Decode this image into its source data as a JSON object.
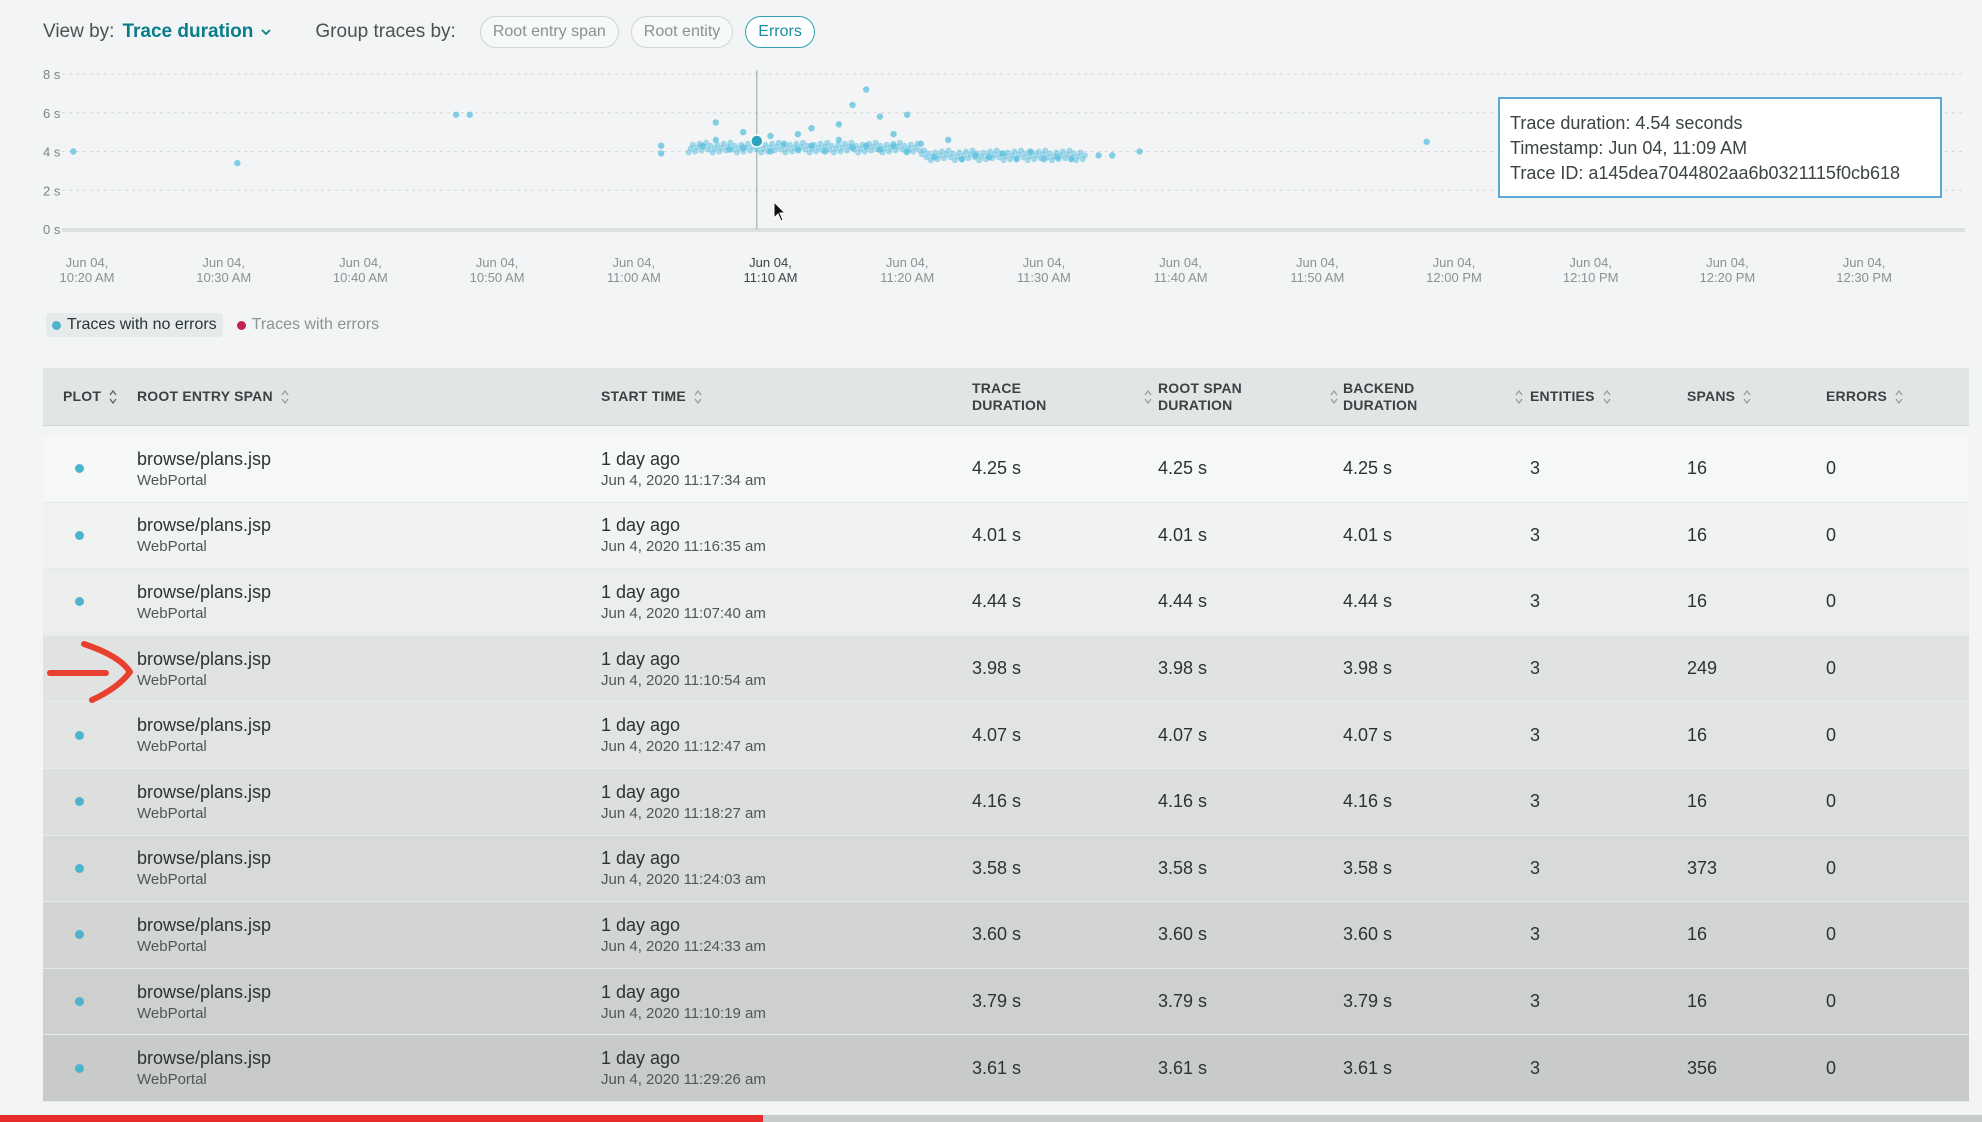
{
  "toolbar": {
    "view_by_label": "View by:",
    "view_by_value": "Trace duration",
    "group_by_label": "Group traces by:",
    "group_options": [
      "Root entry span",
      "Root entity",
      "Errors"
    ],
    "active_group": "Errors"
  },
  "chart_data": {
    "type": "scatter",
    "y_ticks": [
      "8 s",
      "6 s",
      "4 s",
      "2 s",
      "0 s"
    ],
    "ylim": [
      0,
      8
    ],
    "x_ticks": [
      [
        "Jun 04,",
        "10:20 AM"
      ],
      [
        "Jun 04,",
        "10:30 AM"
      ],
      [
        "Jun 04,",
        "10:40 AM"
      ],
      [
        "Jun 04,",
        "10:50 AM"
      ],
      [
        "Jun 04,",
        "11:00 AM"
      ],
      [
        "Jun 04,",
        "11:10 AM"
      ],
      [
        "Jun 04,",
        "11:20 AM"
      ],
      [
        "Jun 04,",
        "11:30 AM"
      ],
      [
        "Jun 04,",
        "11:40 AM"
      ],
      [
        "Jun 04,",
        "11:50 AM"
      ],
      [
        "Jun 04,",
        "12:00 PM"
      ],
      [
        "Jun 04,",
        "12:10 PM"
      ],
      [
        "Jun 04,",
        "12:20 PM"
      ],
      [
        "Jun 04,",
        "12:30 PM"
      ]
    ],
    "highlighted_tick": "11:10 AM",
    "series": [
      {
        "name": "Traces with no errors",
        "color": "#5bc0de",
        "points": [
          [
            "10:19",
            4.0
          ],
          [
            "10:31",
            3.4
          ],
          [
            "10:47",
            5.9
          ],
          [
            "10:48",
            5.9
          ],
          [
            "11:02",
            3.9
          ],
          [
            "11:02",
            4.3
          ],
          [
            "11:05",
            4.3
          ],
          [
            "11:06",
            5.5
          ],
          [
            "11:06",
            4.6
          ],
          [
            "11:07",
            4.1
          ],
          [
            "11:08",
            5.0
          ],
          [
            "11:08",
            4.2
          ],
          [
            "11:09",
            4.3
          ],
          [
            "11:09",
            4.54
          ],
          [
            "11:10",
            4.8
          ],
          [
            "11:10",
            4.0
          ],
          [
            "11:11",
            4.4
          ],
          [
            "11:12",
            4.9
          ],
          [
            "11:12",
            4.1
          ],
          [
            "11:13",
            5.2
          ],
          [
            "11:13",
            4.3
          ],
          [
            "11:14",
            4.0
          ],
          [
            "11:15",
            5.4
          ],
          [
            "11:15",
            4.6
          ],
          [
            "11:16",
            6.4
          ],
          [
            "11:16",
            4.2
          ],
          [
            "11:17",
            7.2
          ],
          [
            "11:17",
            4.3
          ],
          [
            "11:18",
            5.8
          ],
          [
            "11:18",
            4.1
          ],
          [
            "11:19",
            4.9
          ],
          [
            "11:19",
            4.3
          ],
          [
            "11:20",
            5.9
          ],
          [
            "11:20",
            4.0
          ],
          [
            "11:21",
            4.4
          ],
          [
            "11:22",
            3.7
          ],
          [
            "11:23",
            4.6
          ],
          [
            "11:24",
            3.6
          ],
          [
            "11:25",
            3.8
          ],
          [
            "11:26",
            3.7
          ],
          [
            "11:27",
            3.9
          ],
          [
            "11:28",
            3.6
          ],
          [
            "11:29",
            4.0
          ],
          [
            "11:30",
            3.6
          ],
          [
            "11:31",
            3.7
          ],
          [
            "11:32",
            3.6
          ],
          [
            "11:34",
            3.8
          ],
          [
            "11:35",
            3.8
          ],
          [
            "11:37",
            4.0
          ],
          [
            "11:58",
            4.5
          ]
        ]
      },
      {
        "name": "Traces with errors",
        "color": "#c0234d",
        "points": []
      }
    ]
  },
  "tooltip": {
    "line1": "Trace duration: 4.54 seconds",
    "line2": "Timestamp: Jun 04, 11:09 AM",
    "line3": "Trace ID: a145dea7044802aa6b0321115f0cb618"
  },
  "legend": {
    "no_errors": "Traces with no errors",
    "with_errors": "Traces with errors",
    "no_errors_color": "#4fb3cf",
    "with_errors_color": "#c0234d"
  },
  "table": {
    "headers": {
      "plot": "PLOT",
      "root_entry_span": "ROOT ENTRY SPAN",
      "start_time": "START TIME",
      "trace_duration_1": "TRACE",
      "trace_duration_2": "DURATION",
      "root_span_duration_1": "ROOT SPAN",
      "root_span_duration_2": "DURATION",
      "backend_duration_1": "BACKEND",
      "backend_duration_2": "DURATION",
      "entities": "ENTITIES",
      "spans": "SPANS",
      "errors": "ERRORS"
    },
    "rows": [
      {
        "plot": true,
        "span": "browse/plans.jsp",
        "entity": "WebPortal",
        "ago": "1 day ago",
        "ts": "Jun 4, 2020 11:17:34 am",
        "trace": "4.25 s",
        "root": "4.25 s",
        "backend": "4.25 s",
        "entities": "3",
        "spans": "16",
        "errors": "0"
      },
      {
        "plot": true,
        "span": "browse/plans.jsp",
        "entity": "WebPortal",
        "ago": "1 day ago",
        "ts": "Jun 4, 2020 11:16:35 am",
        "trace": "4.01 s",
        "root": "4.01 s",
        "backend": "4.01 s",
        "entities": "3",
        "spans": "16",
        "errors": "0"
      },
      {
        "plot": true,
        "span": "browse/plans.jsp",
        "entity": "WebPortal",
        "ago": "1 day ago",
        "ts": "Jun 4, 2020 11:07:40 am",
        "trace": "4.44 s",
        "root": "4.44 s",
        "backend": "4.44 s",
        "entities": "3",
        "spans": "16",
        "errors": "0"
      },
      {
        "plot": false,
        "span": "browse/plans.jsp",
        "entity": "WebPortal",
        "ago": "1 day ago",
        "ts": "Jun 4, 2020 11:10:54 am",
        "trace": "3.98 s",
        "root": "3.98 s",
        "backend": "3.98 s",
        "entities": "3",
        "spans": "249",
        "errors": "0"
      },
      {
        "plot": true,
        "span": "browse/plans.jsp",
        "entity": "WebPortal",
        "ago": "1 day ago",
        "ts": "Jun 4, 2020 11:12:47 am",
        "trace": "4.07 s",
        "root": "4.07 s",
        "backend": "4.07 s",
        "entities": "3",
        "spans": "16",
        "errors": "0"
      },
      {
        "plot": true,
        "span": "browse/plans.jsp",
        "entity": "WebPortal",
        "ago": "1 day ago",
        "ts": "Jun 4, 2020 11:18:27 am",
        "trace": "4.16 s",
        "root": "4.16 s",
        "backend": "4.16 s",
        "entities": "3",
        "spans": "16",
        "errors": "0"
      },
      {
        "plot": true,
        "span": "browse/plans.jsp",
        "entity": "WebPortal",
        "ago": "1 day ago",
        "ts": "Jun 4, 2020 11:24:03 am",
        "trace": "3.58 s",
        "root": "3.58 s",
        "backend": "3.58 s",
        "entities": "3",
        "spans": "373",
        "errors": "0"
      },
      {
        "plot": true,
        "span": "browse/plans.jsp",
        "entity": "WebPortal",
        "ago": "1 day ago",
        "ts": "Jun 4, 2020 11:24:33 am",
        "trace": "3.60 s",
        "root": "3.60 s",
        "backend": "3.60 s",
        "entities": "3",
        "spans": "16",
        "errors": "0"
      },
      {
        "plot": true,
        "span": "browse/plans.jsp",
        "entity": "WebPortal",
        "ago": "1 day ago",
        "ts": "Jun 4, 2020 11:10:19 am",
        "trace": "3.79 s",
        "root": "3.79 s",
        "backend": "3.79 s",
        "entities": "3",
        "spans": "16",
        "errors": "0"
      },
      {
        "plot": true,
        "span": "browse/plans.jsp",
        "entity": "WebPortal",
        "ago": "1 day ago",
        "ts": "Jun 4, 2020 11:29:26 am",
        "trace": "3.61 s",
        "root": "3.61 s",
        "backend": "3.61 s",
        "entities": "3",
        "spans": "356",
        "errors": "0"
      }
    ],
    "highlighted_row": 3
  },
  "video_progress": 0.385,
  "colors": {
    "accent": "#0a7d8a",
    "trace_dot": "#4fb3cf",
    "error_dot": "#c0234d",
    "annotation_arrow": "#e8402e",
    "progress": "#e52b2b"
  }
}
